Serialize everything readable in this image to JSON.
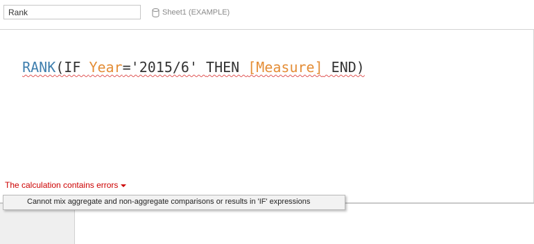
{
  "calc": {
    "name": "Rank",
    "datasource_label": "Sheet1 (EXAMPLE)",
    "datasource_icon": "database-icon"
  },
  "formula": {
    "tokens": [
      {
        "text": "RANK",
        "kind": "function"
      },
      {
        "text": "(IF ",
        "kind": "operator"
      },
      {
        "text": "Year",
        "kind": "field"
      },
      {
        "text": "='2015/6' ",
        "kind": "string"
      },
      {
        "text": "THEN ",
        "kind": "keyword"
      },
      {
        "text": "[Measure]",
        "kind": "field"
      },
      {
        "text": " END)",
        "kind": "keyword"
      }
    ],
    "colors": {
      "function": "#3f7fae",
      "field": "#e48d36",
      "text": "#333333",
      "error_underline": "#e05555"
    }
  },
  "status": {
    "summary": "The calculation contains errors",
    "summary_icon": "caret-down-icon",
    "message": "Cannot mix aggregate and non-aggregate comparisons or results in 'IF' expressions",
    "color": "#cc0000"
  }
}
